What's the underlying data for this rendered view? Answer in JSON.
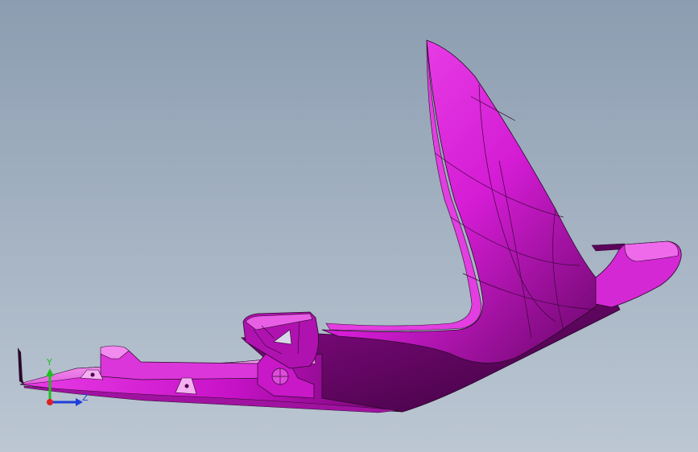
{
  "viewport": {
    "background_top": "#8c9db1",
    "background_bottom": "#bcc7d3"
  },
  "model": {
    "color": "#d21ed2",
    "edge_color": "#2a0a2a"
  },
  "triad": {
    "y_label": "Y",
    "z_label": "Z",
    "y_color": "#1fbf1f",
    "z_color": "#1f3fdc",
    "x_color": "#e01f1f"
  }
}
